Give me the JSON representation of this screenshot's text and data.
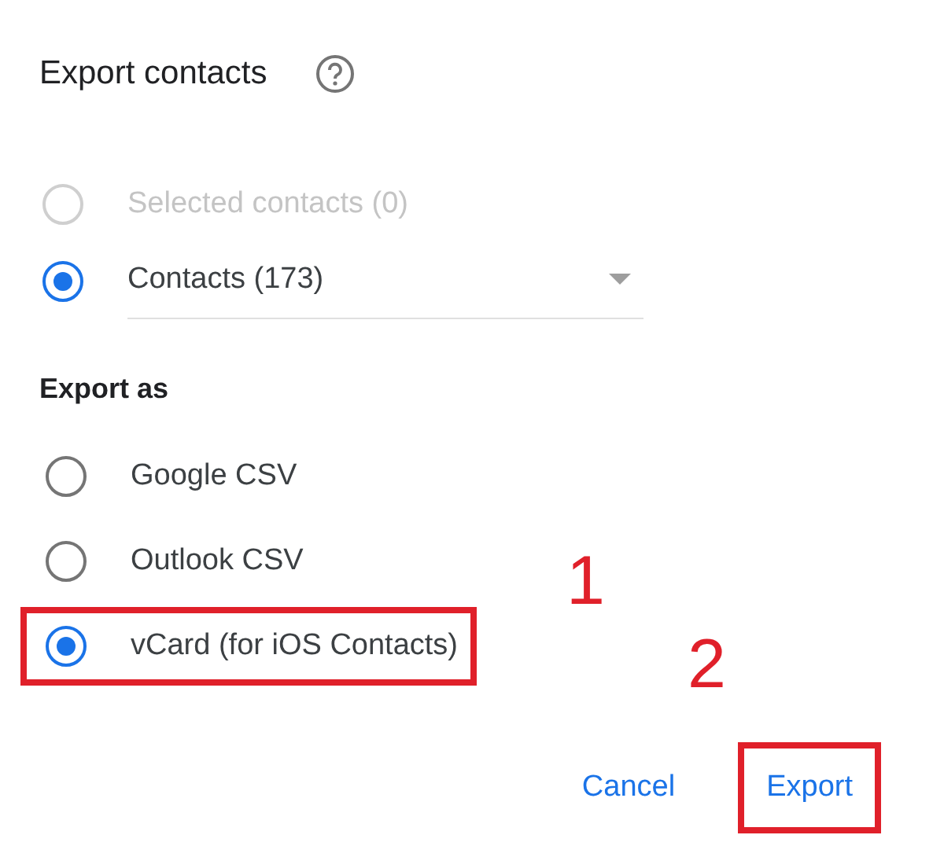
{
  "dialog": {
    "title": "Export contacts",
    "scope_options": [
      {
        "label": "Selected contacts (0)",
        "selected": false,
        "disabled": true,
        "kind": "plain"
      },
      {
        "label": "Contacts (173)",
        "selected": true,
        "disabled": false,
        "kind": "dropdown"
      }
    ],
    "format_heading": "Export as",
    "format_options": [
      {
        "label": "Google CSV",
        "selected": false,
        "highlighted": false
      },
      {
        "label": "Outlook CSV",
        "selected": false,
        "highlighted": false
      },
      {
        "label": "vCard (for iOS Contacts)",
        "selected": true,
        "highlighted": true
      }
    ],
    "buttons": [
      {
        "label": "Cancel",
        "highlighted": false
      },
      {
        "label": "Export",
        "highlighted": true
      }
    ]
  },
  "annotations": [
    {
      "label": "1"
    },
    {
      "label": "2"
    }
  ]
}
